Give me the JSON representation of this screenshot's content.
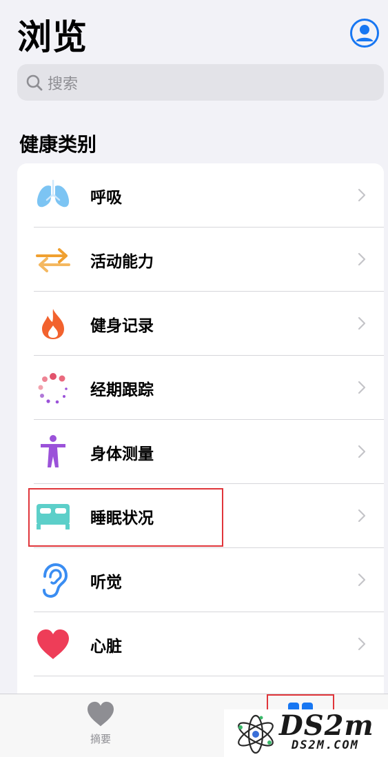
{
  "header": {
    "title": "浏览",
    "profile_icon": "person-circle-icon"
  },
  "search": {
    "placeholder": "搜索",
    "icon": "search-icon"
  },
  "section": {
    "title": "健康类别"
  },
  "categories": [
    {
      "label": "呼吸",
      "icon": "lungs-icon",
      "color": "#6ab8ef"
    },
    {
      "label": "活动能力",
      "icon": "arrows-exchange-icon",
      "color": "#f0a030"
    },
    {
      "label": "健身记录",
      "icon": "flame-icon",
      "color": "#f2622e"
    },
    {
      "label": "经期跟踪",
      "icon": "cycle-dots-icon",
      "color": "#e2536c"
    },
    {
      "label": "身体测量",
      "icon": "figure-icon",
      "color": "#9b52d9"
    },
    {
      "label": "睡眠状况",
      "icon": "bed-icon",
      "color": "#5ccfc9"
    },
    {
      "label": "听觉",
      "icon": "ear-icon",
      "color": "#3a8df2"
    },
    {
      "label": "心脏",
      "icon": "heart-icon",
      "color": "#ee3d58"
    }
  ],
  "tabbar": {
    "summary_label": "摘要",
    "summary_icon": "heart-icon",
    "browse_icon": "grid-icon"
  },
  "watermark": {
    "main": "DS2m",
    "sub": "DS2M.COM"
  }
}
